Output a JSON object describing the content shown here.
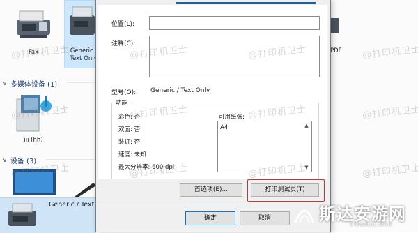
{
  "background": {
    "tiles": [
      {
        "label": "Fax"
      },
      {
        "label": "Generic / Text Only"
      },
      {
        "label": "PDF"
      }
    ],
    "sections": [
      {
        "label": "多媒体设备 (1)"
      },
      {
        "label": "设备 (3)"
      }
    ],
    "media_device_label": "iii (hh)",
    "taskbar_item_label": "Generic / Text O"
  },
  "dialog": {
    "fields": {
      "location_label": "位置(L):",
      "location_value": "",
      "comment_label": "注释(C):",
      "comment_value": "",
      "model_label": "型号(O):",
      "model_value": "Generic / Text Only"
    },
    "features": {
      "title": "功能",
      "color": "彩色: 否",
      "duplex": "双面: 否",
      "staple": "装订: 否",
      "speed": "速度: 未知",
      "max_resolution": "最大分辨率: 600 dpi",
      "paper_label": "可用纸张:",
      "paper_items": [
        "A4"
      ]
    },
    "buttons": {
      "preferences": "首选项(E)...",
      "print_test": "打印测试页(T)",
      "ok": "确定",
      "cancel": "取消"
    }
  },
  "watermarks": {
    "text": "@打印机卫士",
    "logo_cn": "斯达安游网",
    "logo_en": "STANDAL.ORG"
  },
  "colors": {
    "accent": "#0078d7",
    "highlight_red": "#e02a2a",
    "section_header": "#1f3f7a"
  }
}
